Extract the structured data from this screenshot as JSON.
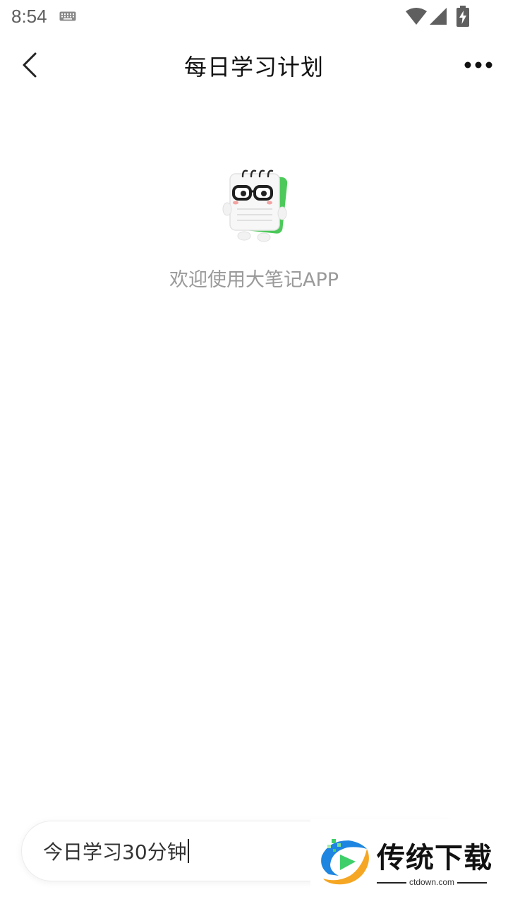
{
  "status_bar": {
    "time": "8:54",
    "icons": [
      "keyboard-icon",
      "wifi-icon",
      "signal-icon",
      "battery-charging-icon"
    ]
  },
  "nav": {
    "title": "每日学习计划",
    "back_icon": "chevron-left-icon",
    "more_icon": "more-dots-icon"
  },
  "empty_state": {
    "mascot": "notebook-mascot-icon",
    "message": "欢迎使用大笔记APP"
  },
  "input": {
    "value": "今日学习30分钟"
  },
  "watermark": {
    "title": "传统下载",
    "subtitle": "ctdown.com"
  },
  "colors": {
    "title_text": "#111111",
    "muted_text": "#9a9a9a",
    "mascot_green": "#4cc95a"
  }
}
